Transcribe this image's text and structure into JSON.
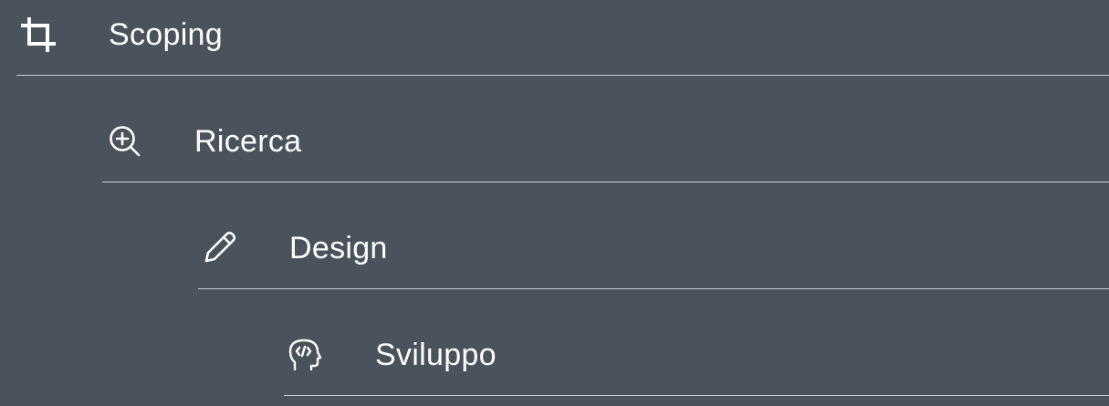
{
  "steps": [
    {
      "label": "Scoping",
      "icon": "crop-icon"
    },
    {
      "label": "Ricerca",
      "icon": "zoom-in-icon"
    },
    {
      "label": "Design",
      "icon": "pencil-icon"
    },
    {
      "label": "Sviluppo",
      "icon": "developer-head-icon"
    }
  ],
  "colors": {
    "background": "#4a535c",
    "text": "#ffffff",
    "divider": "#c9ced3"
  }
}
